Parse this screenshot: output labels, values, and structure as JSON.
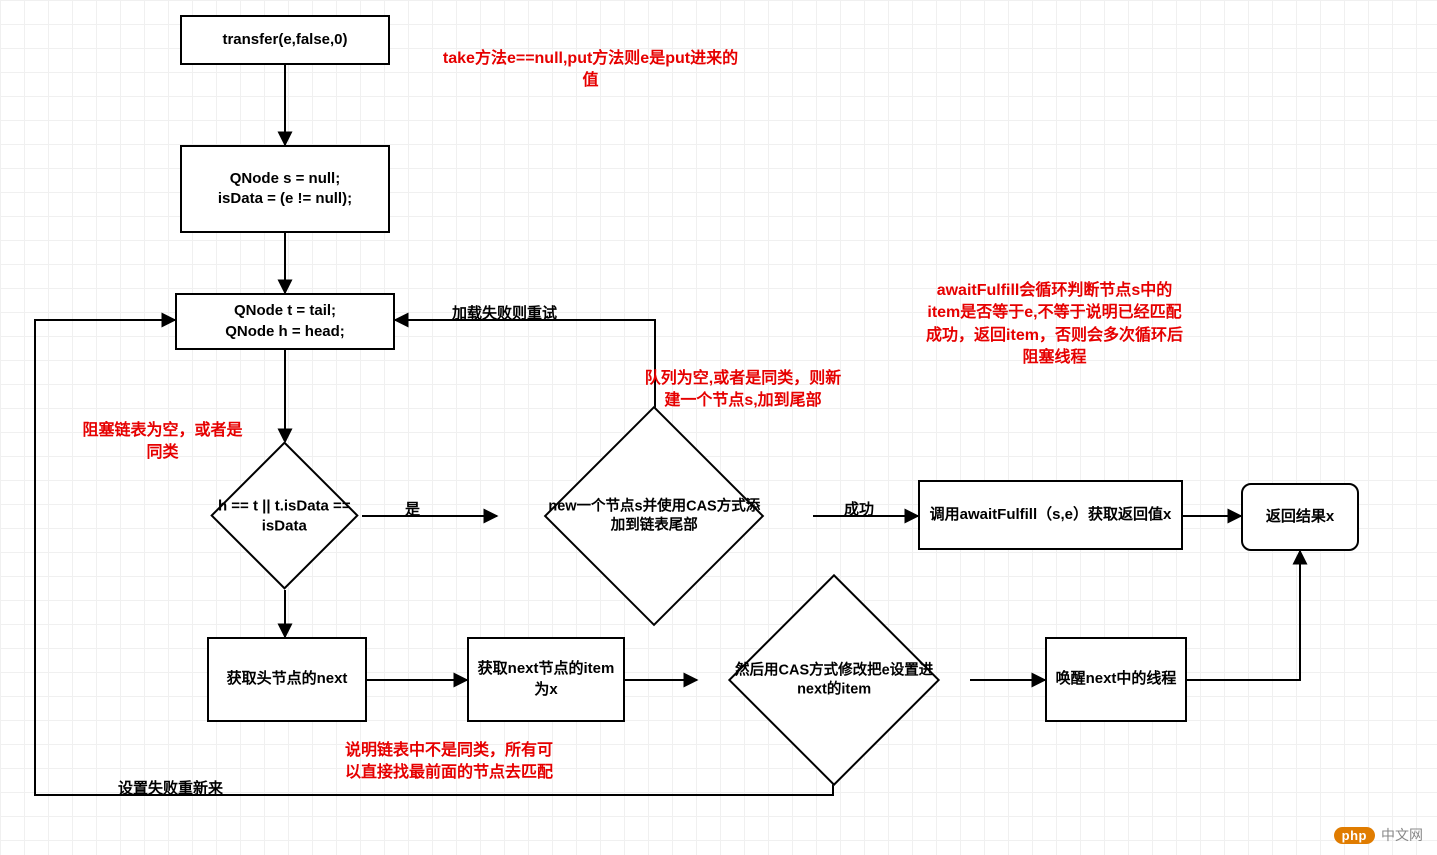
{
  "nodes": {
    "n1": "transfer(e,false,0)",
    "n2": "QNode s = null;\nisData = (e != null);",
    "n3": "QNode t = tail;\nQNode h = head;",
    "d1": "h == t || t.isData == isData",
    "n4": "new一个节点s并使用CAS方式添加到链表尾部",
    "n5": "调用awaitFulfill（s,e）获取返回值x",
    "n6": "返回结果x",
    "n7": "获取头节点的next",
    "n8": "获取next节点的item为x",
    "d2": "然后用CAS方式修改把e设置进next的item",
    "n9": "唤醒next中的线程"
  },
  "edge_labels": {
    "yes": "是",
    "success": "成功",
    "retry_load": "加载失败则重试",
    "retry_set": "设置失败重新来"
  },
  "annotations": {
    "a1": "take方法e==null,put方法则e是put进来的值",
    "a2": "阻塞链表为空，或者是同类",
    "a3": "队列为空,或者是同类，则新建一个节点s,加到尾部",
    "a4": "awaitFulfill会循环判断节点s中的item是否等于e,不等于说明已经匹配成功，返回item，否则会多次循环后阻塞线程",
    "a5": "说明链表中不是同类，所有可以直接找最前面的节点去匹配"
  },
  "watermark": {
    "logo": "php",
    "text": "中文网"
  }
}
